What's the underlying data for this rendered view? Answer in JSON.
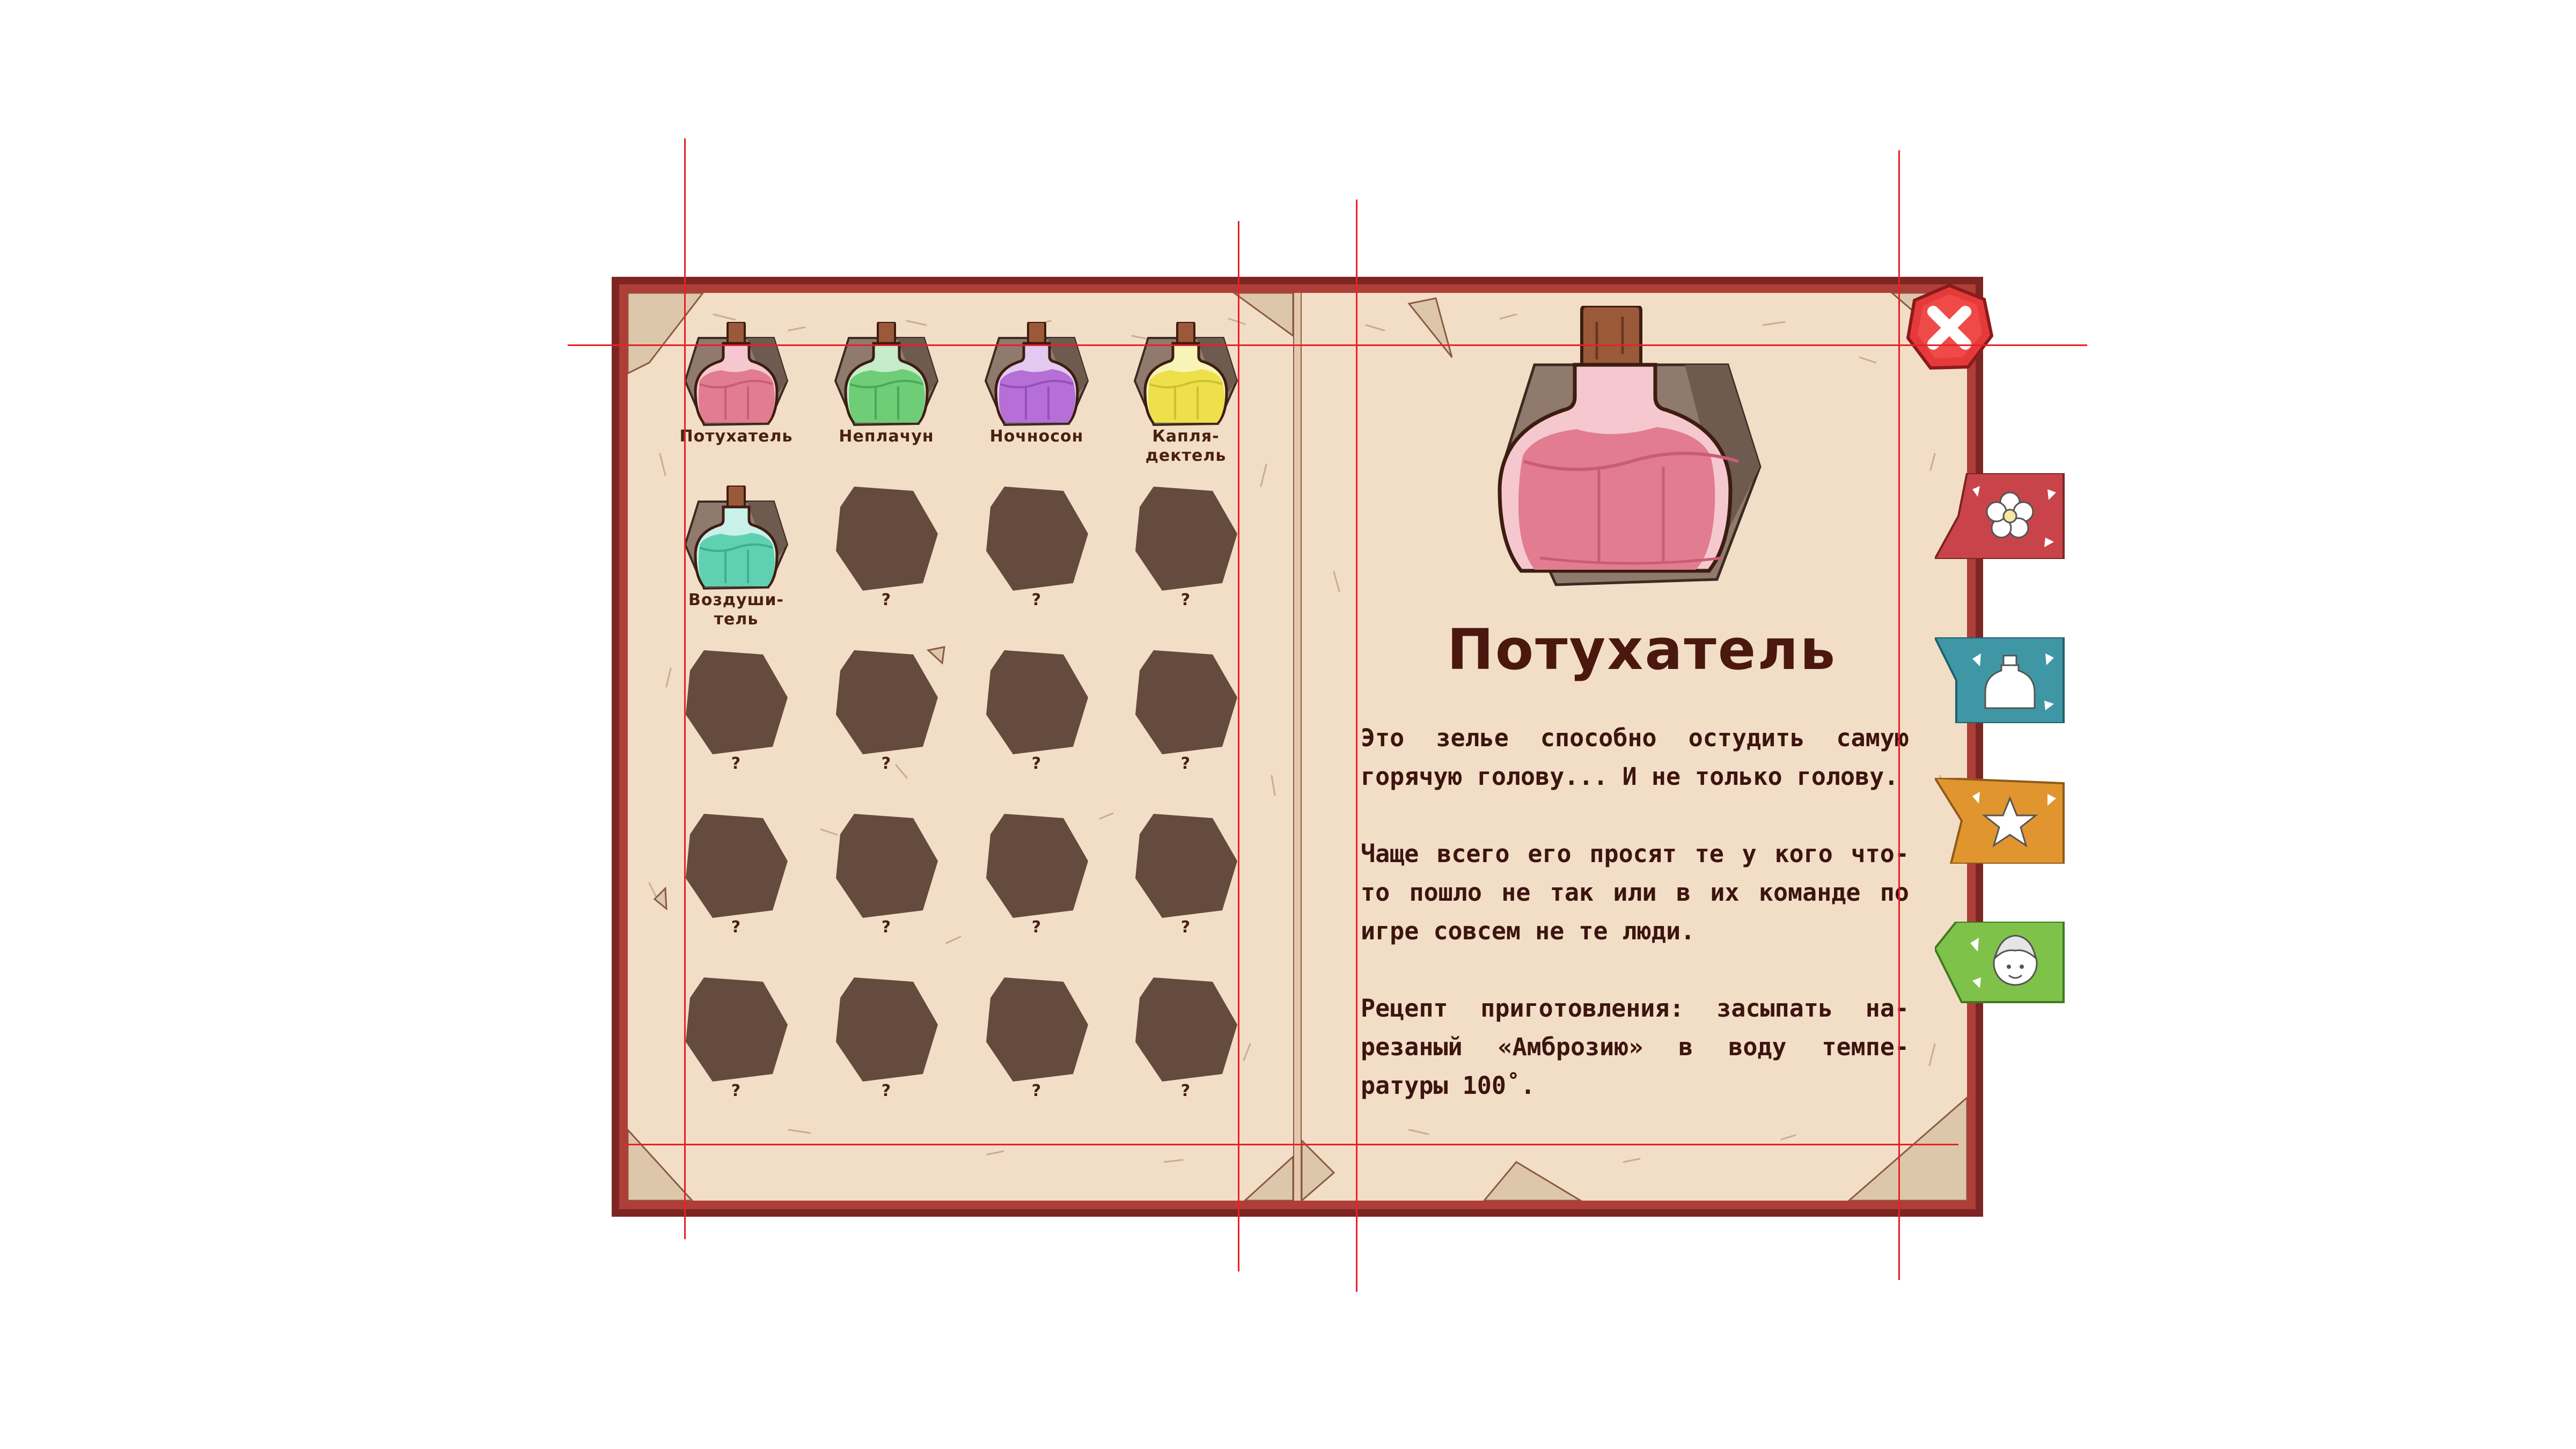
{
  "potions": [
    {
      "label": "Потухатель",
      "discovered": true,
      "liquid": "#e27c90",
      "liquid_dark": "#c85d75",
      "neck": "#f5c8cf",
      "cork": "#9a5a3a"
    },
    {
      "label": "Неплачун",
      "discovered": true,
      "liquid": "#6fcd78",
      "liquid_dark": "#4aa85a",
      "neck": "#c6eccb",
      "cork": "#9a5a3a"
    },
    {
      "label": "Ночносон",
      "discovered": true,
      "liquid": "#b56fd6",
      "liquid_dark": "#9550b8",
      "neck": "#e3c8f0",
      "cork": "#9a5a3a"
    },
    {
      "label": "Капля-\nдектель",
      "discovered": true,
      "liquid": "#eee04a",
      "liquid_dark": "#cfc033",
      "neck": "#f8f3b8",
      "cork": "#9a5a3a"
    },
    {
      "label": "Воздуши-\nтель",
      "discovered": true,
      "liquid": "#5fd1b0",
      "liquid_dark": "#3fae90",
      "neck": "#c9f0ea",
      "cork": "#9a5a3a"
    },
    {
      "label": "?",
      "discovered": false
    },
    {
      "label": "?",
      "discovered": false
    },
    {
      "label": "?",
      "discovered": false
    },
    {
      "label": "?",
      "discovered": false
    },
    {
      "label": "?",
      "discovered": false
    },
    {
      "label": "?",
      "discovered": false
    },
    {
      "label": "?",
      "discovered": false
    },
    {
      "label": "?",
      "discovered": false
    },
    {
      "label": "?",
      "discovered": false
    },
    {
      "label": "?",
      "discovered": false
    },
    {
      "label": "?",
      "discovered": false
    },
    {
      "label": "?",
      "discovered": false
    },
    {
      "label": "?",
      "discovered": false
    },
    {
      "label": "?",
      "discovered": false
    },
    {
      "label": "?",
      "discovered": false
    }
  ],
  "selected": {
    "title": "Потухатель",
    "paragraphs": [
      "Это зелье способно остудить самую горячую голову... И не только голову.",
      "Чаще всего его просят те у кого что-то пошло не так или в их команде по игре совсем не те люди.",
      "Рецепт приготовления: засыпать на-резаный «Амброзию» в воду темпе-ратуры 100˚."
    ]
  },
  "tabs": [
    {
      "icon": "flower-icon",
      "color": "#c8444a"
    },
    {
      "icon": "potion-icon",
      "color": "#3f97a6"
    },
    {
      "icon": "star-icon",
      "color": "#e0952e"
    },
    {
      "icon": "character-icon",
      "color": "#7fc24a"
    }
  ],
  "colors": {
    "book_cover": "#ae3f38",
    "page": "#f2dec6",
    "locked_slot": "#654a3e",
    "text": "#3d1410",
    "guide": "#e8202a"
  }
}
